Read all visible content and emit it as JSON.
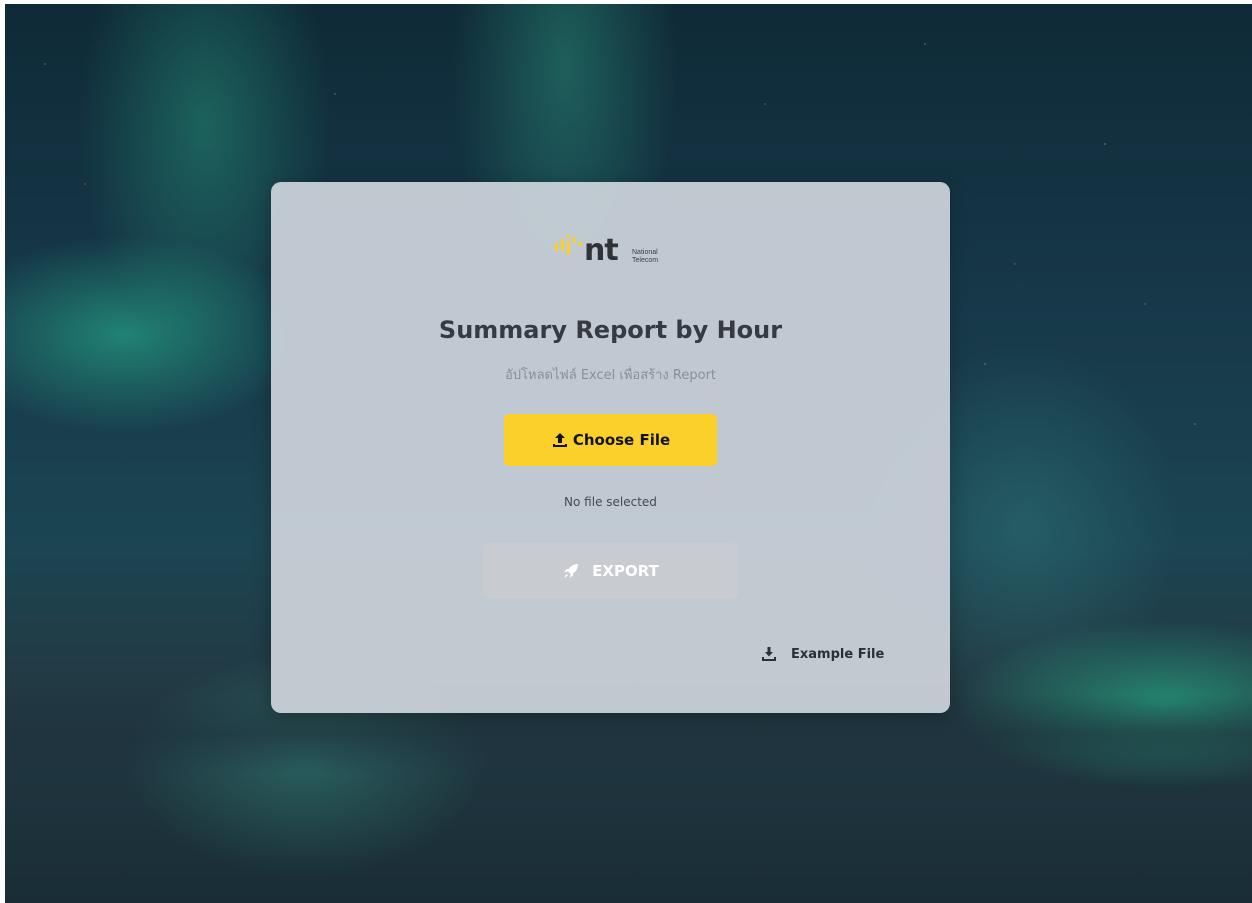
{
  "brand": {
    "logo_text": "nt",
    "name_line1": "National",
    "name_line2": "Telecom"
  },
  "card": {
    "title": "Summary Report by Hour",
    "subtitle": "อัปโหลดไฟล์ Excel เพื่อสร้าง Report"
  },
  "upload": {
    "choose_label": "Choose File",
    "choose_icon": "upload-icon",
    "status": "No file selected"
  },
  "export": {
    "label": "EXPORT",
    "icon": "rocket-icon",
    "enabled": false
  },
  "example": {
    "label": "Example File",
    "icon": "download-icon"
  },
  "colors": {
    "accent": "#fcd02b",
    "disabled": "#c8cbcf",
    "title": "#363b41"
  }
}
